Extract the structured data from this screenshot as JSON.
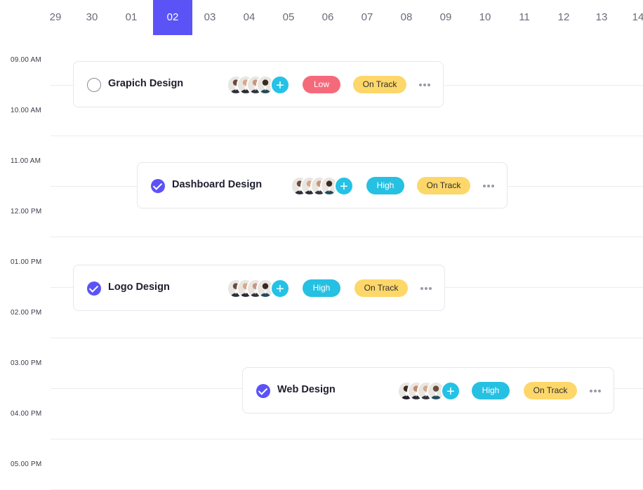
{
  "dates": [
    "29",
    "30",
    "01",
    "02",
    "03",
    "04",
    "05",
    "06",
    "07",
    "08",
    "09",
    "10",
    "11",
    "12",
    "13",
    "14"
  ],
  "active_date": "02",
  "times": [
    "09.00 AM",
    "10.00 AM",
    "11.00 AM",
    "12.00 PM",
    "01.00 PM",
    "02.00 PM",
    "03.00 PM",
    "04.00 PM",
    "05.00 PM"
  ],
  "tasks": [
    {
      "title": "Grapich Design",
      "completed": false,
      "priority": "Low",
      "status": "On Track"
    },
    {
      "title": "Dashboard Design",
      "completed": true,
      "priority": "High",
      "status": "On Track"
    },
    {
      "title": "Logo Design",
      "completed": true,
      "priority": "High",
      "status": "On Track"
    },
    {
      "title": "Web Design",
      "completed": true,
      "priority": "High",
      "status": "On Track"
    }
  ],
  "icons": {
    "add_member": "plus-icon",
    "more": "more-horizontal-icon",
    "check": "checkmark-icon"
  },
  "add_member_symbol": "+",
  "colors": {
    "accent": "#5b53f6",
    "priority_low": "#f56a7b",
    "priority_high": "#26c0e2",
    "status_on_track": "#fdd76a",
    "add_member": "#24c2e6"
  }
}
